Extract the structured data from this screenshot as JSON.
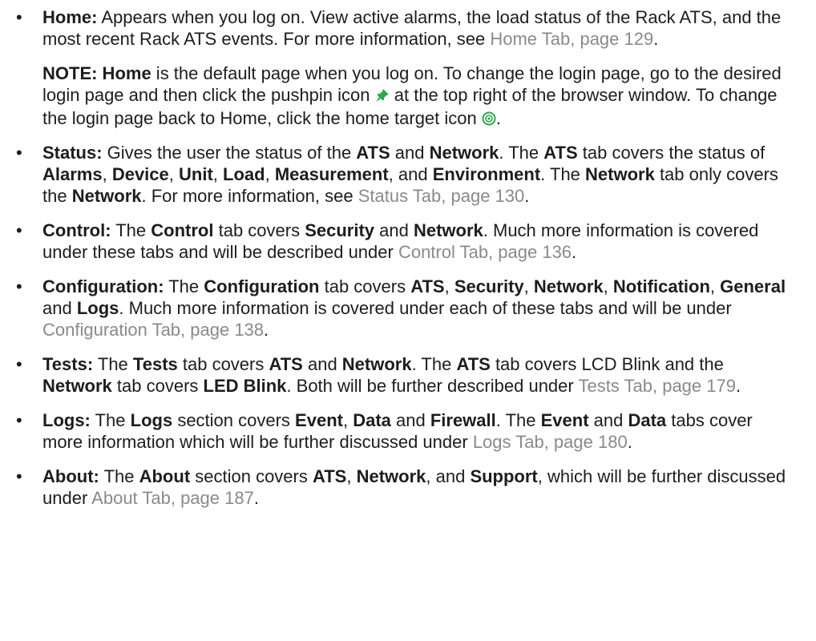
{
  "bullet_char": "•",
  "items": [
    {
      "id": "home",
      "parts": [
        {
          "b": "Home:"
        },
        {
          "t": " Appears when you log on. View active alarms, the load status of the Rack ATS, and the most recent Rack ATS events. For more information, see "
        },
        {
          "l": "Home Tab, page 129"
        },
        {
          "t": "."
        }
      ]
    },
    {
      "id": "status",
      "parts": [
        {
          "b": "Status:"
        },
        {
          "t": " Gives the user the status of the "
        },
        {
          "b": "ATS"
        },
        {
          "t": " and "
        },
        {
          "b": "Network"
        },
        {
          "t": ". The "
        },
        {
          "b": "ATS"
        },
        {
          "t": " tab covers the status of "
        },
        {
          "b": "Alarms"
        },
        {
          "t": ", "
        },
        {
          "b": "Device"
        },
        {
          "t": ", "
        },
        {
          "b": "Unit"
        },
        {
          "t": ", "
        },
        {
          "b": "Load"
        },
        {
          "t": ", "
        },
        {
          "b": "Measurement"
        },
        {
          "t": ", and "
        },
        {
          "b": "Environment"
        },
        {
          "t": ". The "
        },
        {
          "b": "Network"
        },
        {
          "t": " tab only covers the "
        },
        {
          "b": "Network"
        },
        {
          "t": ". For more information, see "
        },
        {
          "l": "Status Tab, page 130"
        },
        {
          "t": "."
        }
      ]
    },
    {
      "id": "control",
      "parts": [
        {
          "b": "Control:"
        },
        {
          "t": " The "
        },
        {
          "b": "Control"
        },
        {
          "t": " tab covers "
        },
        {
          "b": "Security"
        },
        {
          "t": " and "
        },
        {
          "b": "Network"
        },
        {
          "t": ". Much more information is covered under these tabs and will be described under "
        },
        {
          "l": "Control Tab, page 136"
        },
        {
          "t": "."
        }
      ]
    },
    {
      "id": "configuration",
      "parts": [
        {
          "b": "Configuration:"
        },
        {
          "t": " The "
        },
        {
          "b": "Configuration"
        },
        {
          "t": " tab covers "
        },
        {
          "b": "ATS"
        },
        {
          "t": ", "
        },
        {
          "b": "Security"
        },
        {
          "t": ", "
        },
        {
          "b": "Network"
        },
        {
          "t": ", "
        },
        {
          "b": "Notification"
        },
        {
          "t": ", "
        },
        {
          "b": "General"
        },
        {
          "t": " and "
        },
        {
          "b": "Logs"
        },
        {
          "t": ". Much more information is covered under each of these tabs and will be under "
        },
        {
          "l": "Configuration Tab, page 138"
        },
        {
          "t": "."
        }
      ]
    },
    {
      "id": "tests",
      "parts": [
        {
          "b": "Tests:"
        },
        {
          "t": " The "
        },
        {
          "b": "Tests"
        },
        {
          "t": " tab covers "
        },
        {
          "b": "ATS"
        },
        {
          "t": " and "
        },
        {
          "b": "Network"
        },
        {
          "t": ". The "
        },
        {
          "b": "ATS"
        },
        {
          "t": " tab covers LCD Blink and the "
        },
        {
          "b": "Network"
        },
        {
          "t": " tab covers "
        },
        {
          "b": "LED Blink"
        },
        {
          "t": ". Both will be further described under "
        },
        {
          "l": "Tests Tab, page 179"
        },
        {
          "t": "."
        }
      ]
    },
    {
      "id": "logs",
      "parts": [
        {
          "b": "Logs:"
        },
        {
          "t": " The "
        },
        {
          "b": "Logs"
        },
        {
          "t": " section covers "
        },
        {
          "b": "Event"
        },
        {
          "t": ", "
        },
        {
          "b": "Data"
        },
        {
          "t": " and "
        },
        {
          "b": "Firewall"
        },
        {
          "t": ". The "
        },
        {
          "b": "Event"
        },
        {
          "t": " and "
        },
        {
          "b": "Data"
        },
        {
          "t": " tabs cover more information which will be further discussed under "
        },
        {
          "l": "Logs Tab, page 180"
        },
        {
          "t": "."
        }
      ]
    },
    {
      "id": "about",
      "parts": [
        {
          "b": "About:"
        },
        {
          "t": " The "
        },
        {
          "b": "About"
        },
        {
          "t": " section covers "
        },
        {
          "b": "ATS"
        },
        {
          "t": ", "
        },
        {
          "b": "Network"
        },
        {
          "t": ", and "
        },
        {
          "b": "Support"
        },
        {
          "t": ", which will be further discussed under "
        },
        {
          "l": "About Tab, page 187"
        },
        {
          "t": "."
        }
      ]
    }
  ],
  "note": {
    "parts": [
      {
        "b": "NOTE: Home"
      },
      {
        "t": " is the default page when you log on. To change the login page, go to the desired login page and then click the pushpin icon "
      },
      {
        "icon": "pushpin-icon"
      },
      {
        "t": " at the top right of the browser window. To change the login page back to Home, click the home target icon "
      },
      {
        "icon": "home-target-icon"
      },
      {
        "t": "."
      }
    ]
  },
  "colors": {
    "text": "#1d1d1d",
    "link": "#8a8a8a",
    "icon_green": "#2aa84a"
  }
}
